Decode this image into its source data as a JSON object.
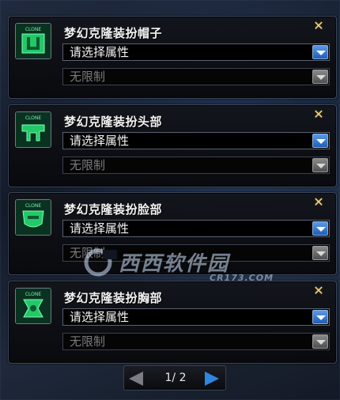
{
  "items": [
    {
      "title": "梦幻克隆装扮帽子",
      "attribute_select": "请选择属性",
      "limit_select": "无限制",
      "icon": "clone-hat-icon"
    },
    {
      "title": "梦幻克隆装扮头部",
      "attribute_select": "请选择属性",
      "limit_select": "无限制",
      "icon": "clone-head-icon"
    },
    {
      "title": "梦幻克隆装扮脸部",
      "attribute_select": "请选择属性",
      "limit_select": "无限制",
      "icon": "clone-face-icon"
    },
    {
      "title": "梦幻克隆装扮胸部",
      "attribute_select": "请选择属性",
      "limit_select": "无限制",
      "icon": "clone-chest-icon"
    }
  ],
  "icon_badge_text": "CLONE",
  "close_glyph": "✕",
  "pager": {
    "text": "1/ 2",
    "current_page": 1,
    "total_pages": 2
  },
  "watermark": {
    "text": "西西软件园",
    "sub": "CR173.COM"
  },
  "colors": {
    "icon_green": "#2ee07a",
    "close_gold": "#f3d58a",
    "dropdown_blue": "#2f78d6",
    "pager_next_blue": "#2f86e0"
  }
}
